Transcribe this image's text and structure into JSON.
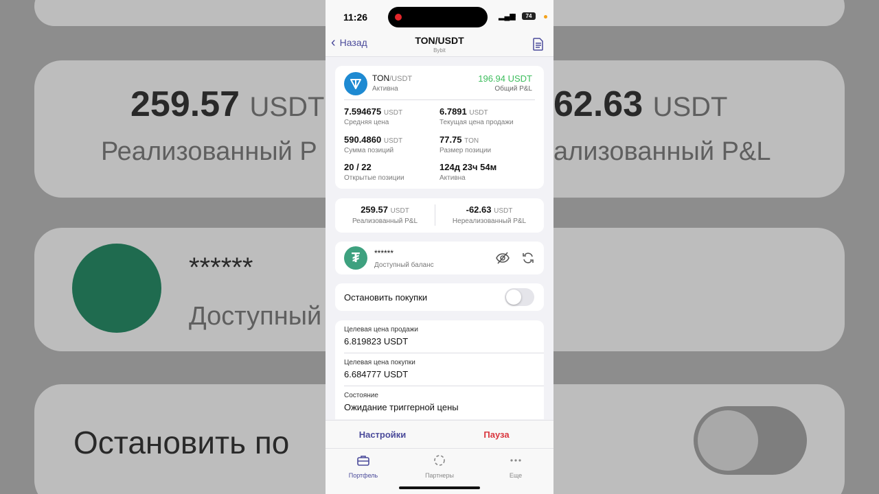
{
  "status_bar": {
    "time": "11:26",
    "battery": "74"
  },
  "nav": {
    "back_label": "Назад",
    "title": "TON/USDT",
    "subtitle": "Bybit"
  },
  "bot_card": {
    "base": "TON",
    "quote": "/USDT",
    "status": "Активна",
    "pnl_value": "196.94 USDT",
    "pnl_label": "Общий P&L",
    "stats": [
      {
        "value": "7.594675",
        "unit": "USDT",
        "label": "Средняя цена"
      },
      {
        "value": "6.7891",
        "unit": "USDT",
        "label": "Текущая цена продажи"
      },
      {
        "value": "590.4860",
        "unit": "USDT",
        "label": "Сумма позиций"
      },
      {
        "value": "77.75",
        "unit": "TON",
        "label": "Размер позиции"
      },
      {
        "value": "20 / 22",
        "unit": "",
        "label": "Открытые позиции"
      },
      {
        "value": "124д 23ч 54м",
        "unit": "",
        "label": "Активна"
      }
    ]
  },
  "pnl_card": {
    "realized_value": "259.57",
    "realized_unit": "USDT",
    "realized_label": "Реализованный P&L",
    "unrealized_value": "-62.63",
    "unrealized_unit": "USDT",
    "unrealized_label": "Нереализованный P&L"
  },
  "balance_card": {
    "masked": "******",
    "label": "Доступный баланс"
  },
  "stop_buying": {
    "label": "Остановить покупки",
    "enabled": false
  },
  "details": [
    {
      "label": "Целевая цена продажи",
      "value": "6.819823 USDT"
    },
    {
      "label": "Целевая цена покупки",
      "value": "6.684777 USDT"
    },
    {
      "label": "Состояние",
      "value": "Ожидание триггерной цены"
    }
  ],
  "actions": {
    "settings": "Настройки",
    "pause": "Пауза"
  },
  "tabs": [
    {
      "label": "Портфель",
      "icon": "briefcase-icon",
      "active": true
    },
    {
      "label": "Партнеры",
      "icon": "partners-icon",
      "active": false
    },
    {
      "label": "Еще",
      "icon": "more-icon",
      "active": false
    }
  ],
  "background_zoom": {
    "realized_value": "259.57",
    "unit": "USDT",
    "realized_label": "Реализованный P",
    "unrealized_value": "62.63",
    "unrealized_label": "ализованный P&L",
    "masked": "******",
    "balance_label": "Доступный",
    "stop_label": "Остановить по"
  },
  "colors": {
    "accent": "#4a4a9a",
    "positive": "#3cbd5c",
    "pause": "#d9363e",
    "ton": "#1e8ad2",
    "usdt": "#3ea17f"
  }
}
